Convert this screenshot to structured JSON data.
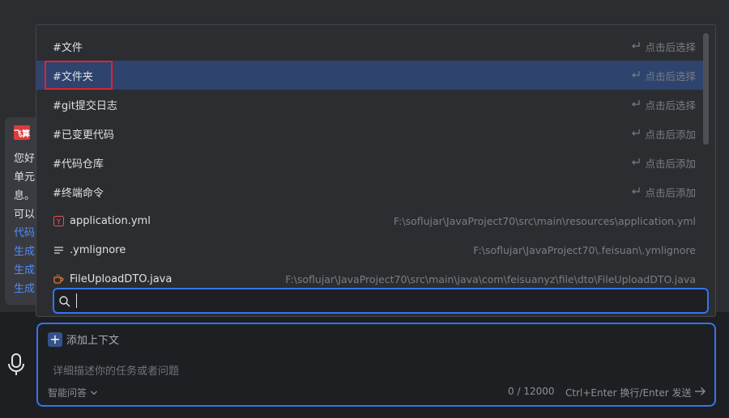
{
  "chat": {
    "brand": "飞算",
    "lines": [
      "您好",
      "单元",
      "息。",
      "可以"
    ],
    "links": [
      "代码",
      "生成",
      "生成",
      "生成"
    ]
  },
  "popup": {
    "items": [
      {
        "label": "#文件",
        "hint": "点击后选择",
        "selected": false
      },
      {
        "label": "#文件夹",
        "hint": "点击后选择",
        "selected": true
      },
      {
        "label": "#git提交日志",
        "hint": "点击后选择",
        "selected": false
      },
      {
        "label": "#已变更代码",
        "hint": "点击后添加",
        "selected": false
      },
      {
        "label": "#代码仓库",
        "hint": "点击后添加",
        "selected": false
      },
      {
        "label": "#终端命令",
        "hint": "点击后添加",
        "selected": false
      }
    ],
    "files": [
      {
        "name": "application.yml",
        "path": "F:\\soflujar\\JavaProject70\\src\\main\\resources\\application.yml",
        "icon": "yaml-file-icon",
        "icon_color": "#e0555a"
      },
      {
        "name": ".ymlignore",
        "path": "F:\\soflujar\\JavaProject70\\.feisuan\\.ymlignore",
        "icon": "text-file-icon",
        "icon_color": "#cfd2d6"
      },
      {
        "name": "FileUploadDTO.java",
        "path": "F:\\soflujar\\JavaProject70\\src\\main\\java\\com\\feisuanyz\\file\\dto\\FileUploadDTO.java",
        "icon": "java-file-icon",
        "icon_color": "#e07a3a"
      }
    ],
    "search_value": ""
  },
  "composer": {
    "add_context": "添加上下文",
    "placeholder": "详细描述你的任务或者问题",
    "mode": "智能问答",
    "count": "0",
    "count_sep": "/",
    "max": "12000",
    "send_hint": "Ctrl+Enter 换行/Enter 发送"
  },
  "colors": {
    "accent": "#3574f0",
    "selection": "#2e436e",
    "highlight": "#e0232e"
  }
}
